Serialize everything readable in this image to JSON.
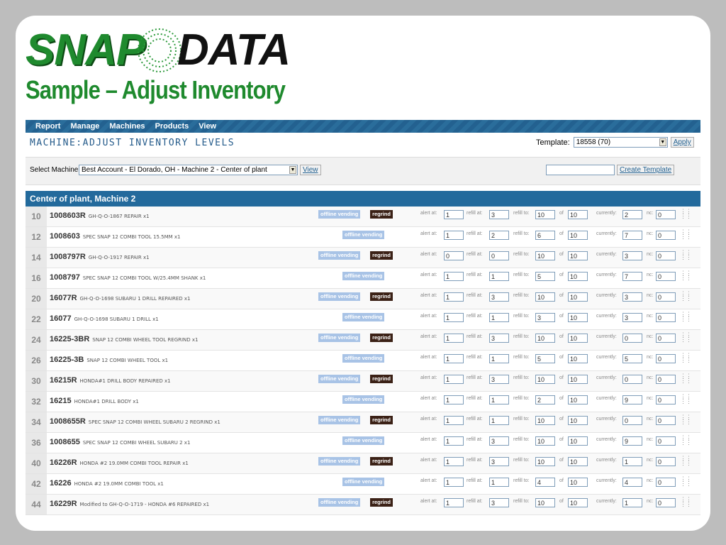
{
  "logo": {
    "part1": "SNAP",
    "part2": "DATA"
  },
  "slide_title": "Sample – Adjust Inventory",
  "menu": [
    "Report",
    "Manage",
    "Machines",
    "Products",
    "View"
  ],
  "page_title": "MACHINE:ADJUST INVENTORY LEVELS",
  "template": {
    "label": "Template:",
    "value": "18558 (70)",
    "apply": "Apply"
  },
  "select_machine": {
    "label": "Select Machine:",
    "value": "Best Account - El Dorado, OH - Machine 2 - Center of plant",
    "view": "View"
  },
  "create_template": {
    "input": "",
    "button": "Create Template"
  },
  "panel_title": "Center of plant, Machine 2",
  "labels": {
    "offline": "offline vending",
    "regrind": "regrind",
    "alert": "alert at:",
    "refill_at": "refill at:",
    "refill_to": "refill to:",
    "of": "of",
    "currently": "currently:",
    "nc": "nc:"
  },
  "rows": [
    {
      "num": "10",
      "code": "1008603R",
      "desc": "GH-Q-O-1867 REPAIR x1",
      "regrind": true,
      "alert": "1",
      "refill_at": "3",
      "refill_to": "10",
      "of": "10",
      "currently": "2",
      "nc": "0"
    },
    {
      "num": "12",
      "code": "1008603",
      "desc": "SPEC SNAP 12 COMBI TOOL 15.5MM x1",
      "regrind": false,
      "alert": "1",
      "refill_at": "2",
      "refill_to": "6",
      "of": "10",
      "currently": "7",
      "nc": "0"
    },
    {
      "num": "14",
      "code": "1008797R",
      "desc": "GH-Q-O-1917 REPAIR x1",
      "regrind": true,
      "alert": "0",
      "refill_at": "0",
      "refill_to": "10",
      "of": "10",
      "currently": "3",
      "nc": "0"
    },
    {
      "num": "16",
      "code": "1008797",
      "desc": "SPEC SNAP 12 COMBI TOOL W/25.4MM SHANK x1",
      "regrind": false,
      "alert": "1",
      "refill_at": "1",
      "refill_to": "5",
      "of": "10",
      "currently": "7",
      "nc": "0"
    },
    {
      "num": "20",
      "code": "16077R",
      "desc": "GH-Q-O-1698 SUBARU 1 DRILL REPAIRED x1",
      "regrind": true,
      "alert": "1",
      "refill_at": "3",
      "refill_to": "10",
      "of": "10",
      "currently": "3",
      "nc": "0"
    },
    {
      "num": "22",
      "code": "16077",
      "desc": "GH-Q-O-1698 SUBARU 1 DRILL x1",
      "regrind": false,
      "alert": "1",
      "refill_at": "1",
      "refill_to": "3",
      "of": "10",
      "currently": "3",
      "nc": "0"
    },
    {
      "num": "24",
      "code": "16225-3BR",
      "desc": "SNAP 12 COMBI WHEEL TOOL REGRIND x1",
      "regrind": true,
      "alert": "1",
      "refill_at": "3",
      "refill_to": "10",
      "of": "10",
      "currently": "0",
      "nc": "0"
    },
    {
      "num": "26",
      "code": "16225-3B",
      "desc": "SNAP 12 COMBI WHEEL TOOL x1",
      "regrind": false,
      "alert": "1",
      "refill_at": "1",
      "refill_to": "5",
      "of": "10",
      "currently": "5",
      "nc": "0"
    },
    {
      "num": "30",
      "code": "16215R",
      "desc": "HONDA#1 DRILL BODY REPAIRED x1",
      "regrind": true,
      "alert": "1",
      "refill_at": "3",
      "refill_to": "10",
      "of": "10",
      "currently": "0",
      "nc": "0"
    },
    {
      "num": "32",
      "code": "16215",
      "desc": "HONDA#1 DRILL BODY x1",
      "regrind": false,
      "alert": "1",
      "refill_at": "1",
      "refill_to": "2",
      "of": "10",
      "currently": "9",
      "nc": "0"
    },
    {
      "num": "34",
      "code": "1008655R",
      "desc": "SPEC SNAP 12 COMBI WHEEL SUBARU 2 REGRIND x1",
      "regrind": true,
      "alert": "1",
      "refill_at": "1",
      "refill_to": "10",
      "of": "10",
      "currently": "0",
      "nc": "0"
    },
    {
      "num": "36",
      "code": "1008655",
      "desc": "SPEC SNAP 12 COMBI WHEEL SUBARU 2 x1",
      "regrind": false,
      "alert": "1",
      "refill_at": "3",
      "refill_to": "10",
      "of": "10",
      "currently": "9",
      "nc": "0"
    },
    {
      "num": "40",
      "code": "16226R",
      "desc": "HONDA #2 19.0MM COMBI TOOL REPAIR x1",
      "regrind": true,
      "alert": "1",
      "refill_at": "3",
      "refill_to": "10",
      "of": "10",
      "currently": "1",
      "nc": "0"
    },
    {
      "num": "42",
      "code": "16226",
      "desc": "HONDA #2 19.0MM COMBI TOOL x1",
      "regrind": false,
      "alert": "1",
      "refill_at": "1",
      "refill_to": "4",
      "of": "10",
      "currently": "4",
      "nc": "0"
    },
    {
      "num": "44",
      "code": "16229R",
      "desc": "Modified to GH-Q-O-1719 - HONDA #6 REPAIRED x1",
      "regrind": true,
      "alert": "1",
      "refill_at": "3",
      "refill_to": "10",
      "of": "10",
      "currently": "1",
      "nc": "0"
    }
  ],
  "colors": {
    "brand_green": "#1f8a2e",
    "header_blue": "#236a9c",
    "regrind_brown": "#3b2116",
    "offline_blue": "#a8c3e6"
  }
}
